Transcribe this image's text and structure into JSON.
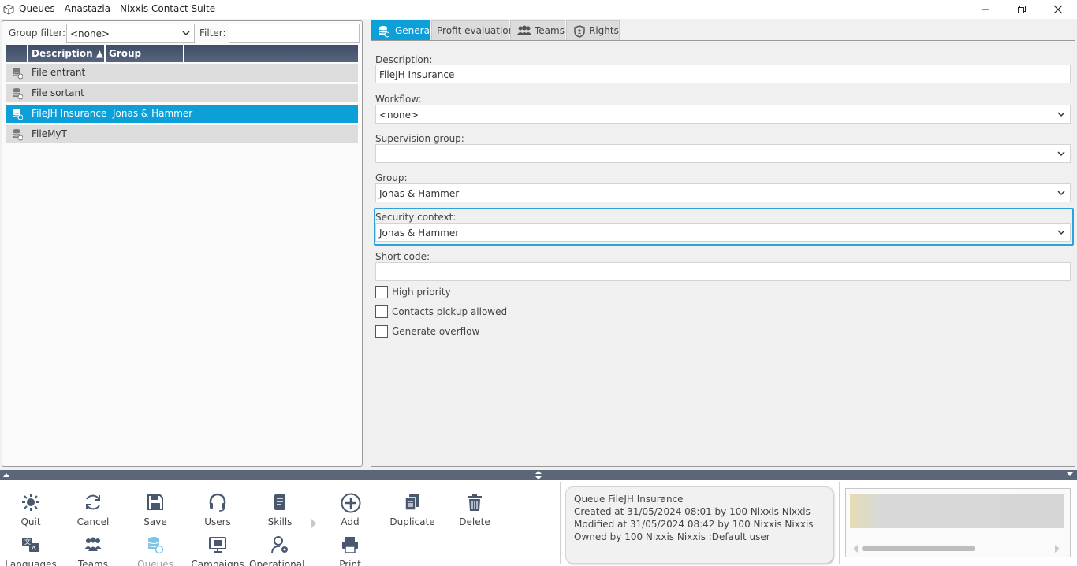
{
  "window": {
    "title": "Queues - Anastazia - Nixxis Contact Suite"
  },
  "left": {
    "group_filter_label": "Group filter:",
    "group_filter_value": "<none>",
    "filter_label": "Filter:",
    "filter_value": "",
    "columns": [
      "Description ▲",
      "Group"
    ],
    "rows": [
      {
        "description": "File entrant",
        "group": "",
        "selected": false
      },
      {
        "description": "File sortant",
        "group": "",
        "selected": false
      },
      {
        "description": "FileJH Insurance",
        "group": "Jonas & Hammer",
        "selected": true
      },
      {
        "description": "FileMyT",
        "group": "",
        "selected": false
      }
    ]
  },
  "tabs": [
    {
      "label": "General",
      "icon": "queue-icon",
      "active": true
    },
    {
      "label": "Profit evaluation",
      "icon": "",
      "active": false
    },
    {
      "label": "Teams",
      "icon": "teams-icon",
      "active": false
    },
    {
      "label": "Rights",
      "icon": "shield-icon",
      "active": false
    }
  ],
  "form": {
    "description_label": "Description:",
    "description_value": "FileJH Insurance",
    "workflow_label": "Workflow:",
    "workflow_value": "<none>",
    "supervision_label": "Supervision group:",
    "supervision_value": "",
    "group_label": "Group:",
    "group_value": "Jonas & Hammer",
    "security_label": "Security context:",
    "security_value": "Jonas & Hammer",
    "short_code_label": "Short code:",
    "short_code_value": "",
    "high_priority_label": "High priority",
    "high_priority_checked": false,
    "pickup_label": "Contacts pickup allowed",
    "pickup_checked": false,
    "overflow_label": "Generate overflow",
    "overflow_checked": false
  },
  "toolbar": {
    "quit": "Quit",
    "cancel": "Cancel",
    "save": "Save",
    "users": "Users",
    "skills": "Skills",
    "languages": "Languages",
    "teams": "Teams",
    "queues": "Queues",
    "campaigns": "Campaigns",
    "operational": "Operational...",
    "add": "Add",
    "duplicate": "Duplicate",
    "delete": "Delete",
    "print": "Print"
  },
  "info": {
    "line1": "Queue FileJH Insurance",
    "line2": "Created at 31/05/2024 08:01 by 100 Nixxis Nixxis",
    "line3": "Modified at 31/05/2024 08:42 by 100 Nixxis Nixxis",
    "line4": "Owned by 100 Nixxis Nixxis :Default user"
  },
  "colors": {
    "accent": "#0d9fd8",
    "header": "#4a586f",
    "focus": "#2ea3db"
  }
}
